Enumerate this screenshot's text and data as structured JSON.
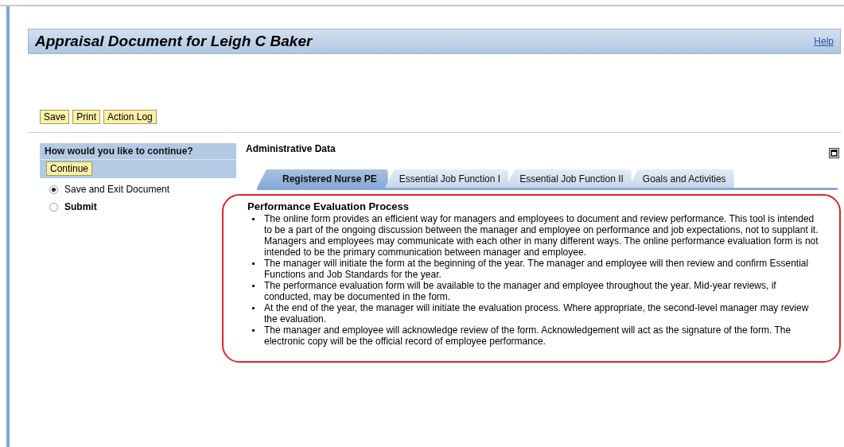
{
  "header": {
    "title": "Appraisal Document for Leigh C Baker",
    "help_link": "Help"
  },
  "toolbar": [
    "Save",
    "Print",
    "Action Log"
  ],
  "continue_panel": {
    "question": "How would you like to continue?",
    "button": "Continue",
    "options": [
      {
        "label": "Save and Exit Document",
        "selected": true,
        "emphasized": false
      },
      {
        "label": "Submit",
        "selected": false,
        "emphasized": true
      }
    ]
  },
  "section_title": "Administrative Data",
  "tabs": [
    {
      "label": "Registered Nurse PE",
      "selected": true
    },
    {
      "label": "Essential Job Function I",
      "selected": false
    },
    {
      "label": "Essential Job Function II",
      "selected": false
    },
    {
      "label": "Goals and Activities",
      "selected": false
    }
  ],
  "content": {
    "heading": "Performance Evaluation Process",
    "bullets": [
      "The online form provides an efficient way for managers and employees to document and review performance. This tool is intended to be a part of the ongoing discussion between the manager and employee on performance and job expectations, not to supplant it. Managers and employees may communicate with each other in many different ways. The online performance evaluation form is not intended to be the primary communication between manager and employee.",
      "The manager will initiate the form at the beginning of the year. The manager and employee will then review and confirm Essential Functions and Job Standards for the year.",
      "The performance evaluation form will be available to the manager and employee throughout the year. Mid-year reviews, if conducted, may be documented in the form.",
      "At the end of the year, the manager will initiate the evaluation process. Where appropriate, the second-level manager may review the evaluation.",
      "The manager and employee will acknowledge review of the form. Acknowledgement will act as the signature of the form. The electronic copy will be the official record of employee performance."
    ]
  }
}
